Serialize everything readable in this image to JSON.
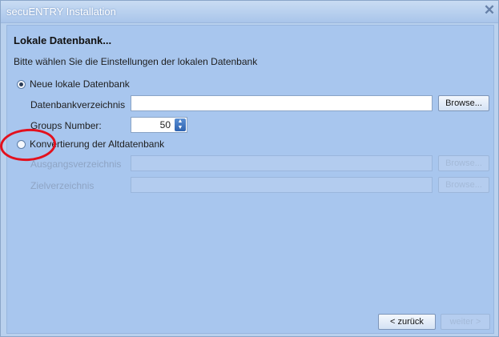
{
  "window": {
    "title": "secuENTRY Installation",
    "close_glyph": "✕"
  },
  "page": {
    "heading": "Lokale Datenbank...",
    "subheading": "Bitte wählen Sie die Einstellungen der lokalen Datenbank"
  },
  "option_new": {
    "label": "Neue lokale Datenbank",
    "checked": true,
    "directory_label": "Datenbankverzeichnis",
    "directory_value": "",
    "browse_label": "Browse...",
    "groups_label": "Groups Number:",
    "groups_value": "50"
  },
  "option_convert": {
    "label": "Konvertierung der Altdatenbank",
    "checked": false,
    "source_label": "Ausgangsverzeichnis",
    "source_value": "",
    "source_browse_label": "Browse...",
    "target_label": "Zielverzeichnis",
    "target_value": "",
    "target_browse_label": "Browse..."
  },
  "footer": {
    "back_label": "< zurück",
    "next_label": "weiter >"
  },
  "colors": {
    "background": "#a8c6ee",
    "highlight_circle": "#e3111e"
  },
  "icons": {
    "close": "close-icon",
    "spinner": "spinner-arrows-icon"
  }
}
